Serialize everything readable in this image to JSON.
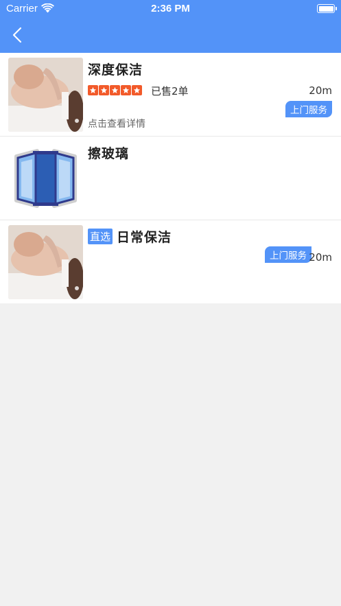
{
  "status_bar": {
    "carrier": "Carrier",
    "time": "2:36 PM"
  },
  "colors": {
    "accent": "#5393f8",
    "star": "#f25a2a",
    "background": "#f1f1f1"
  },
  "items": [
    {
      "title": "深度保洁",
      "rating": 5,
      "sold": "已售2单",
      "distance": "20m",
      "service": "上门服务",
      "detail": "点击查看详情",
      "image": "massage-photo"
    },
    {
      "title": "擦玻璃",
      "image": "window-icon"
    },
    {
      "tag": "直选",
      "title": "日常保洁",
      "service": "上门服务",
      "distance": "20m",
      "image": "massage-photo"
    }
  ]
}
